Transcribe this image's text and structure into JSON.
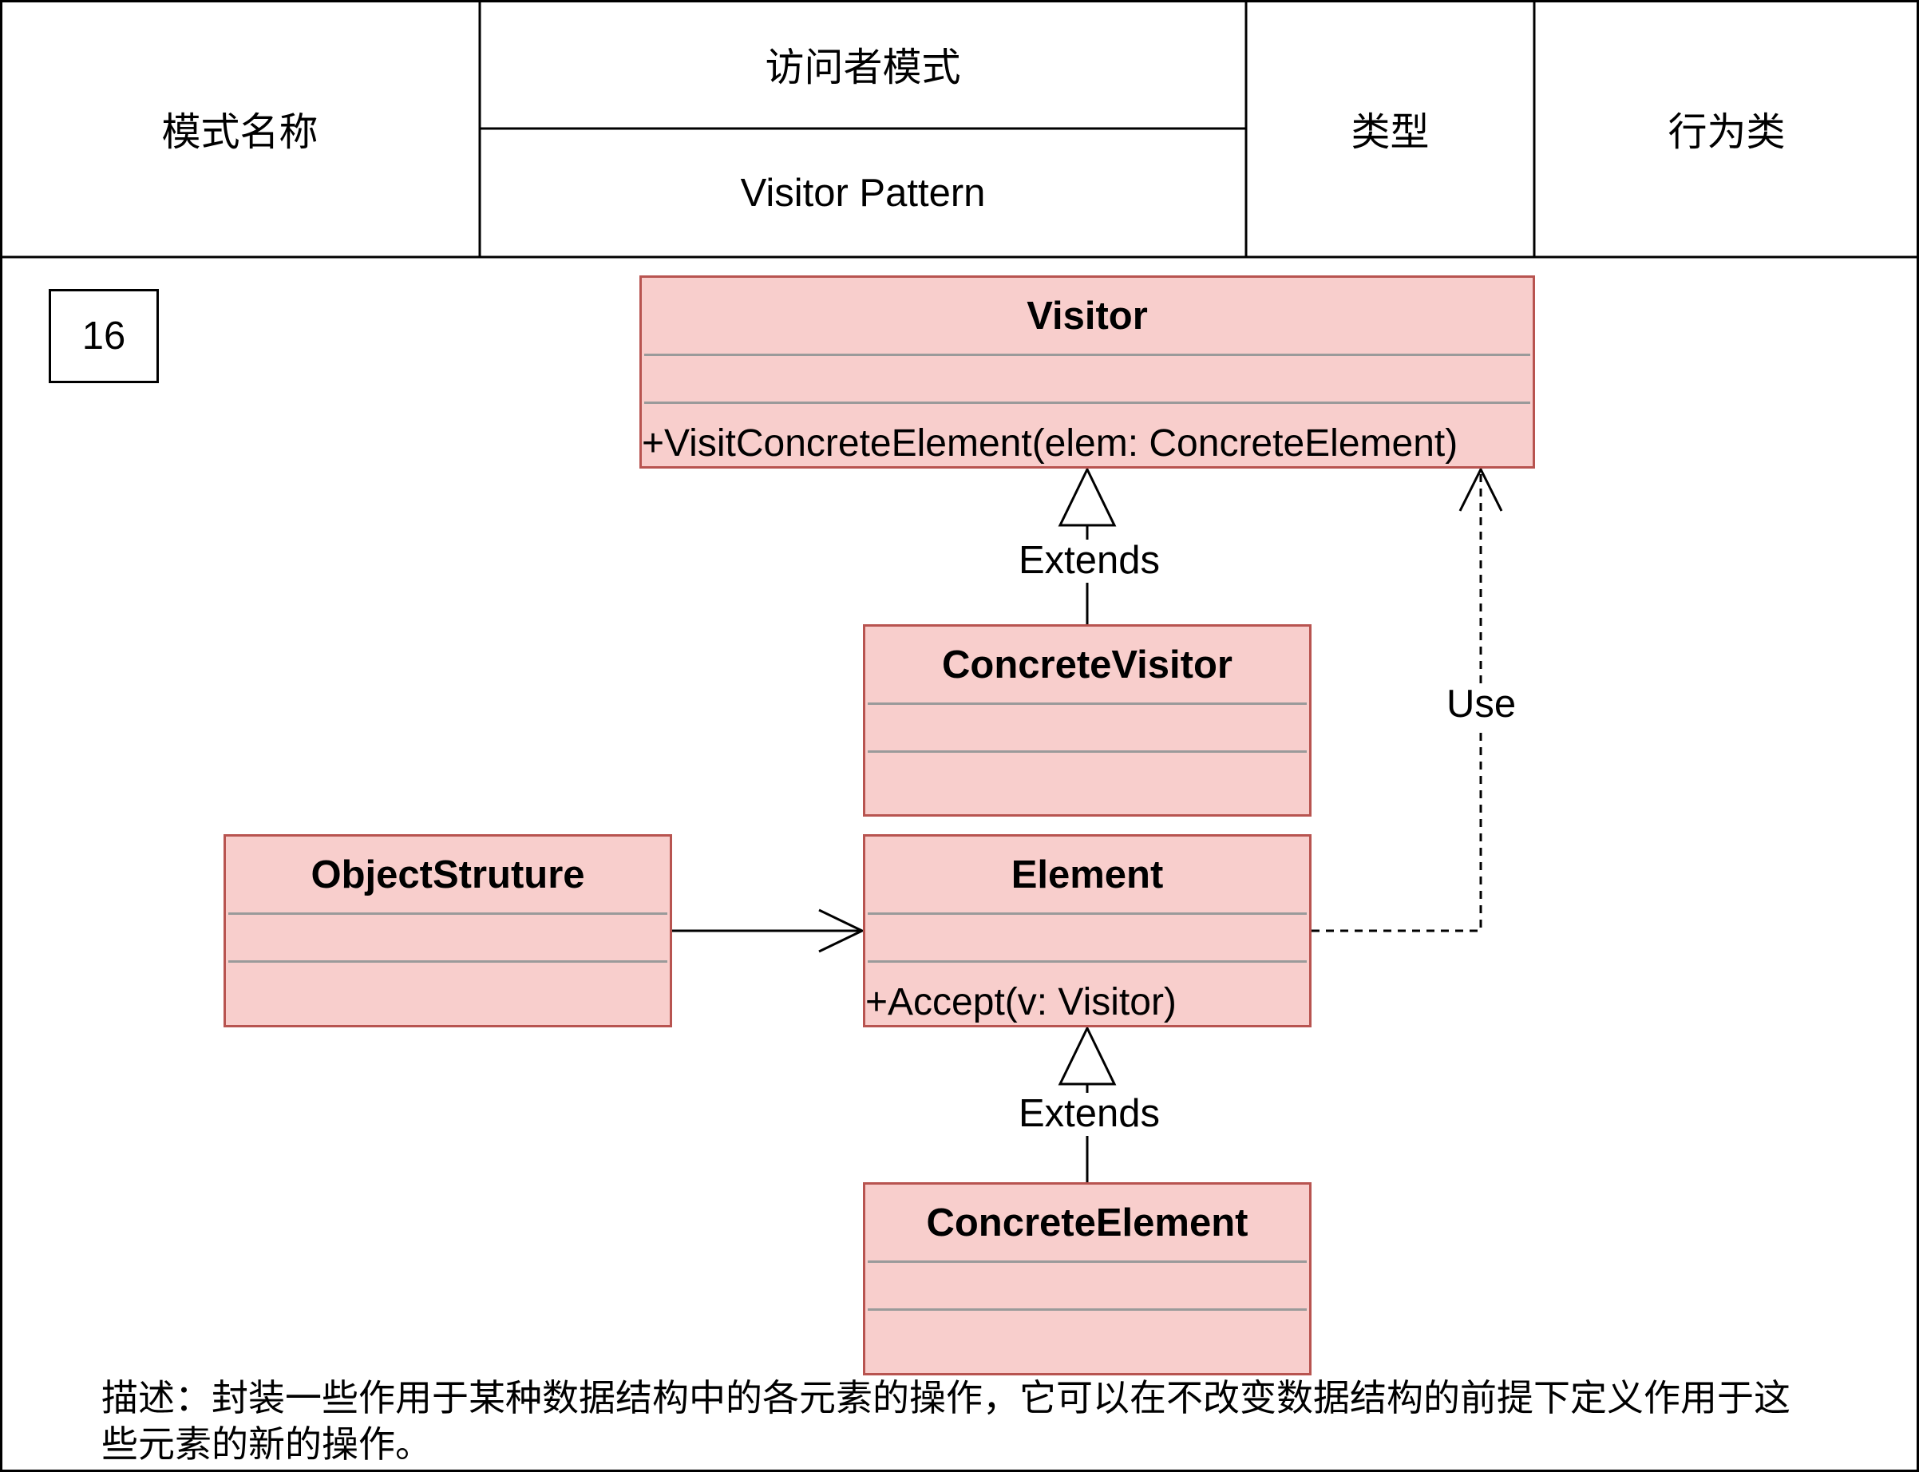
{
  "header": {
    "name_label": "模式名称",
    "name_cn": "访问者模式",
    "name_en": "Visitor Pattern",
    "type_label": "类型",
    "type_value": "行为类"
  },
  "badge_number": "16",
  "classes": {
    "visitor": {
      "name": "Visitor",
      "operation": "+VisitConcreteElement(elem: ConcreteElement)"
    },
    "concrete_visitor": {
      "name": "ConcreteVisitor"
    },
    "element": {
      "name": "Element",
      "operation": "+Accept(v: Visitor)"
    },
    "object_structure": {
      "name": "ObjectStruture"
    },
    "concrete_element": {
      "name": "ConcreteElement"
    }
  },
  "relations": {
    "extends_visitor": "Extends",
    "extends_element": "Extends",
    "use": "Use"
  },
  "description": "描述：封装一些作用于某种数据结构中的各元素的操作，它可以在不改变数据结构的前提下定义作用于这些元素的新的操作。",
  "colors": {
    "class_fill": "#f8cecc",
    "class_border": "#b85450",
    "separator": "#9a9a9a"
  }
}
